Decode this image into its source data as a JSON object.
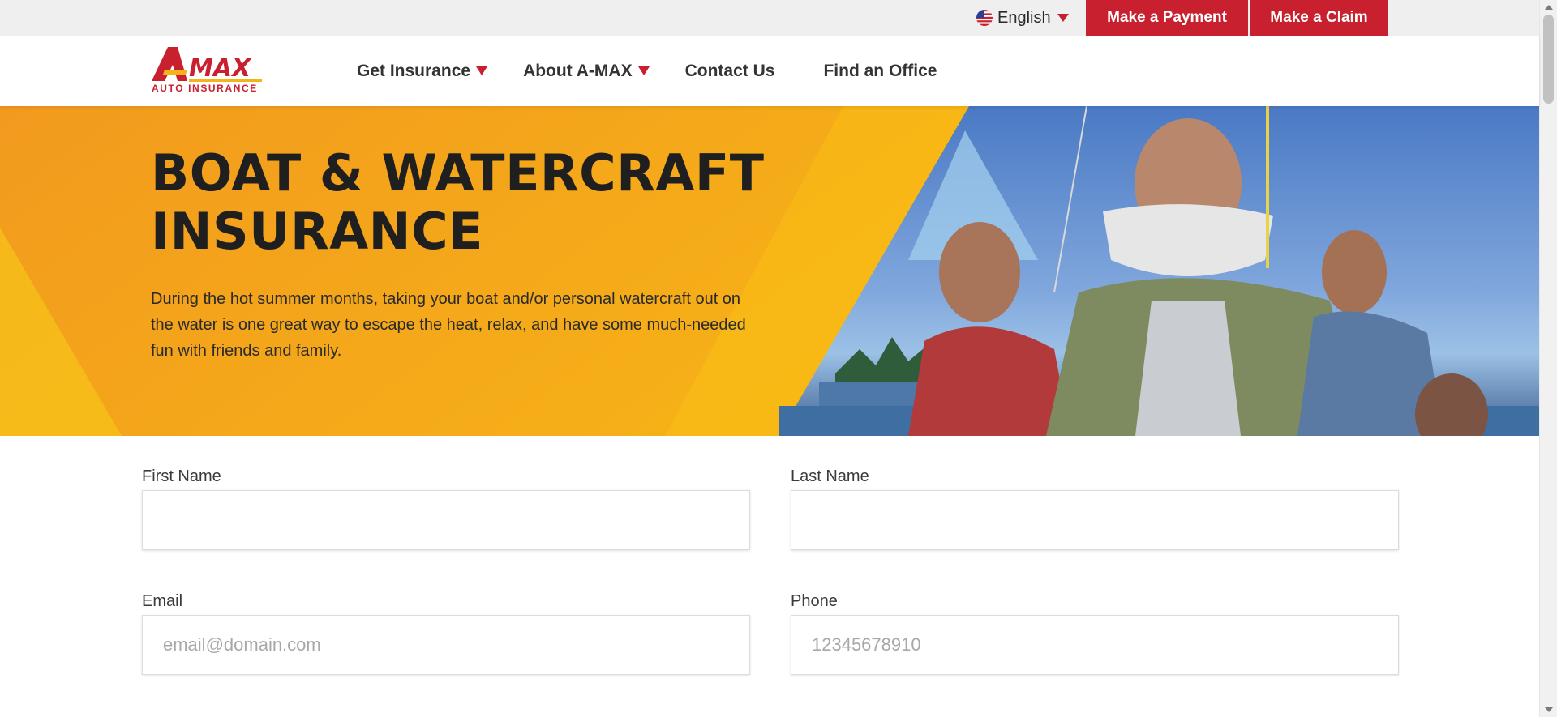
{
  "utility_bar": {
    "language_label": "English",
    "language_icon": "us-flag-icon",
    "payment_label": "Make a Payment",
    "claim_label": "Make a Claim"
  },
  "brand": {
    "logo_text": "A·MAX",
    "logo_subtitle": "AUTO INSURANCE",
    "accent_color": "#c8202f",
    "hero_color": "#f3a623"
  },
  "nav": {
    "items": [
      {
        "label": "Get Insurance",
        "has_dropdown": true
      },
      {
        "label": "About A-MAX",
        "has_dropdown": true
      },
      {
        "label": "Contact Us",
        "has_dropdown": false
      },
      {
        "label": "Find an Office",
        "has_dropdown": false
      }
    ]
  },
  "hero": {
    "title_line1": "BOAT & WATERCRAFT",
    "title_line2": "INSURANCE",
    "description": "During the hot summer months, taking your boat and/or personal watercraft out on the water is one great way to escape the heat, relax, and have some much-needed fun with friends and family."
  },
  "form": {
    "first_name_label": "First Name",
    "first_name_placeholder": "",
    "last_name_label": "Last Name",
    "last_name_placeholder": "",
    "email_label": "Email",
    "email_placeholder": "email@domain.com",
    "phone_label": "Phone",
    "phone_placeholder": "12345678910"
  }
}
